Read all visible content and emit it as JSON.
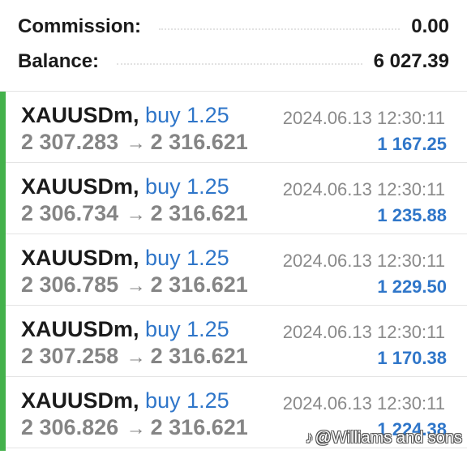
{
  "summary": {
    "commission_label": "Commission:",
    "commission_value": "0.00",
    "balance_label": "Balance:",
    "balance_value": "6 027.39"
  },
  "trades": [
    {
      "symbol": "XAUUSDm,",
      "side": "buy 1.25",
      "time": "2024.06.13 12:30:11",
      "open_price": "2 307.283",
      "arrow": "→",
      "close_price": "2 316.621",
      "profit": "1 167.25"
    },
    {
      "symbol": "XAUUSDm,",
      "side": "buy 1.25",
      "time": "2024.06.13 12:30:11",
      "open_price": "2 306.734",
      "arrow": "→",
      "close_price": "2 316.621",
      "profit": "1 235.88"
    },
    {
      "symbol": "XAUUSDm,",
      "side": "buy 1.25",
      "time": "2024.06.13 12:30:11",
      "open_price": "2 306.785",
      "arrow": "→",
      "close_price": "2 316.621",
      "profit": "1 229.50"
    },
    {
      "symbol": "XAUUSDm,",
      "side": "buy 1.25",
      "time": "2024.06.13 12:30:11",
      "open_price": "2 307.258",
      "arrow": "→",
      "close_price": "2 316.621",
      "profit": "1 170.38"
    },
    {
      "symbol": "XAUUSDm,",
      "side": "buy 1.25",
      "time": "2024.06.13 12:30:11",
      "open_price": "2 306.826",
      "arrow": "→",
      "close_price": "2 316.621",
      "profit": "1 224.38"
    }
  ],
  "watermark": {
    "icon": "tiktok-icon",
    "text": "@Williams and sons"
  },
  "colors": {
    "accent": "#43b14b",
    "profit": "#2f76c9",
    "side": "#2f76c9"
  }
}
